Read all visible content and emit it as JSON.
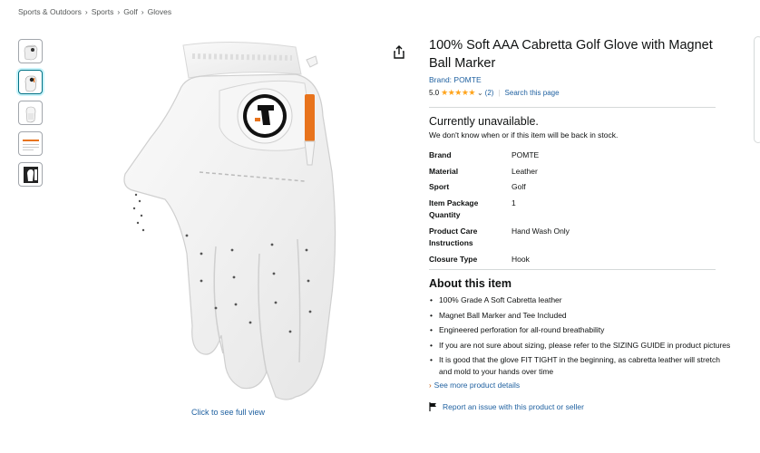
{
  "breadcrumb": [
    "Sports & Outdoors",
    "Sports",
    "Golf",
    "Gloves"
  ],
  "breadcrumb_separator": "›",
  "product": {
    "title": "100% Soft AAA Cabretta Golf Glove with Magnet Ball Marker",
    "brand_link": "Brand: POMTE",
    "rating": "5.0",
    "stars": "★★★★★",
    "review_count": "(2)",
    "search_page": "Search this page"
  },
  "availability": {
    "status": "Currently unavailable.",
    "detail": "We don't know when or if this item will be back in stock."
  },
  "specs": [
    {
      "key": "Brand",
      "value": "POMTE"
    },
    {
      "key": "Material",
      "value": "Leather"
    },
    {
      "key": "Sport",
      "value": "Golf"
    },
    {
      "key": "Item Package Quantity",
      "value": "1"
    },
    {
      "key": "Product Care Instructions",
      "value": "Hand Wash Only"
    },
    {
      "key": "Closure Type",
      "value": "Hook"
    }
  ],
  "about": {
    "title": "About this item",
    "bullets": [
      "100% Grade A Soft Cabretta leather",
      "Magnet Ball Marker and Tee Included",
      "Engineered perforation for all-round breathability",
      "If you are not sure about sizing, please refer to the SIZING GUIDE in product pictures",
      "It is good that the glove FIT TIGHT in the beginning, as cabretta leather will stretch and mold to your hands over time"
    ],
    "see_more": "See more product details"
  },
  "report_issue": "Report an issue with this product or seller",
  "image": {
    "full_view_label": "Click to see full view",
    "thumbnail_count": 5,
    "selected_thumbnail": 2
  },
  "colors": {
    "link": "#2162a1",
    "star": "#ffa41c",
    "tee": "#e8731c"
  }
}
